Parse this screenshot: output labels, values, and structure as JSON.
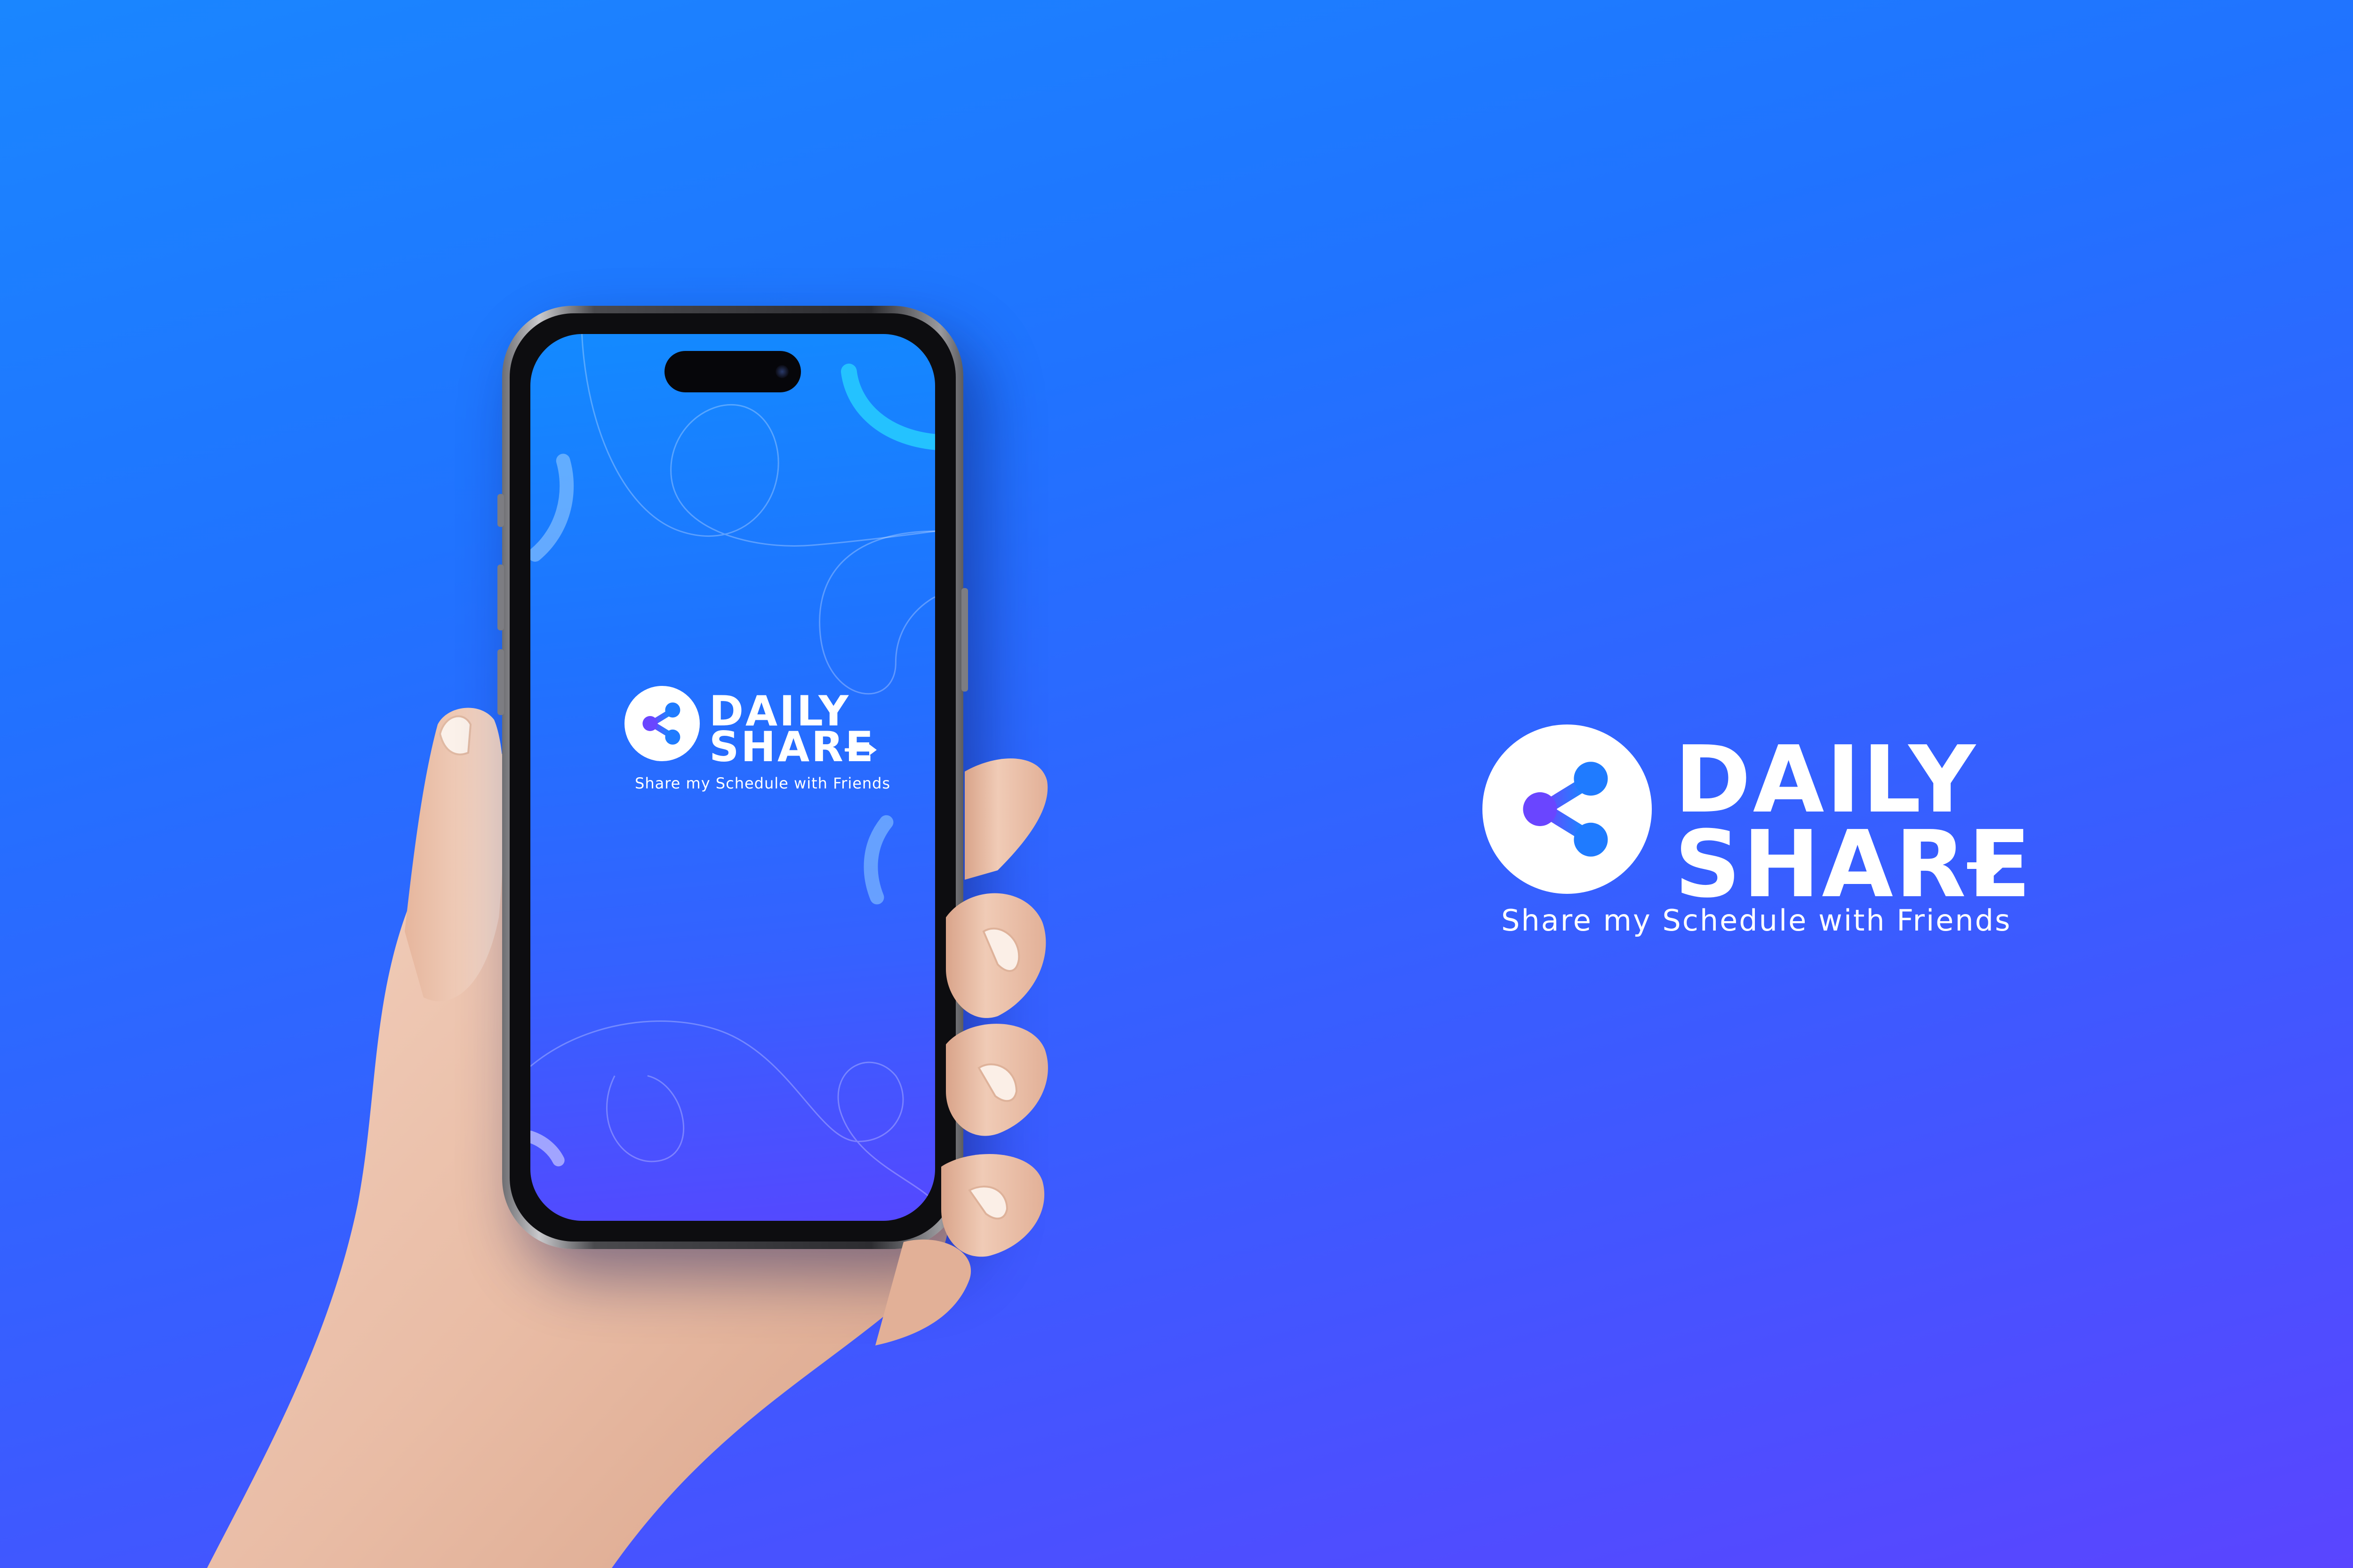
{
  "brand": {
    "word_line1": "DAILY",
    "word_line2": "SHARE",
    "tagline": "Share my Schedule with Friends"
  },
  "phone_screen": {
    "word_line1": "DAILY",
    "word_line2": "SHARE",
    "tagline": "Share my Schedule with Friends"
  },
  "icons": {
    "brand_icon": "share-icon",
    "word_arrow": "arrow-right-icon"
  },
  "colors": {
    "background_top": "#1a86ff",
    "background_bottom": "#5a45ff",
    "brand_white": "#ffffff",
    "icon_gradient_start": "#6a45ff",
    "icon_gradient_end": "#148cff"
  }
}
